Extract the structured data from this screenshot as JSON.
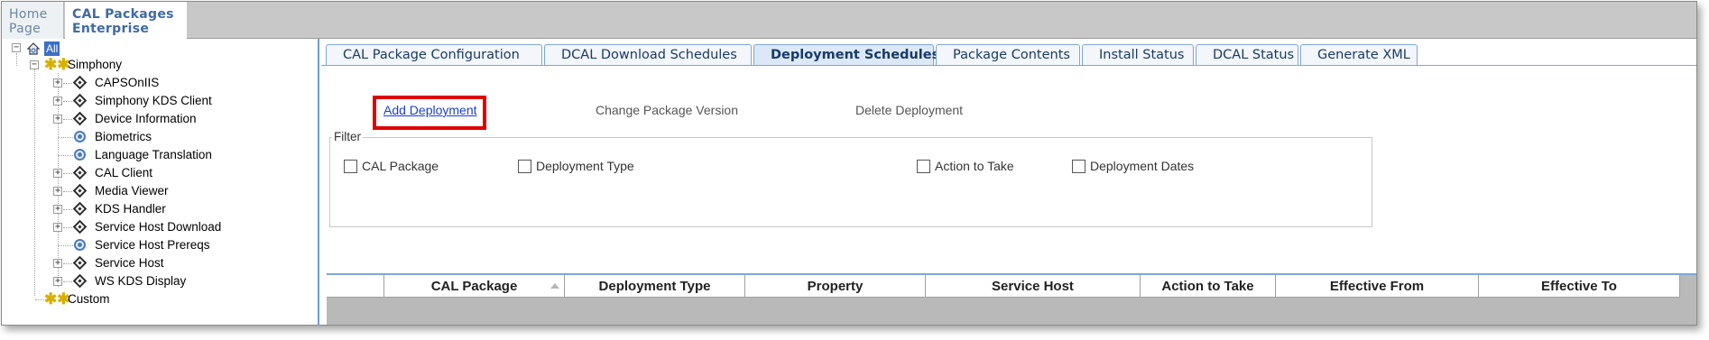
{
  "topnav": {
    "home_line1": "Home",
    "home_line2": "Page",
    "cal_line1": "CAL Packages",
    "cal_line2": "Enterprise"
  },
  "tree": {
    "root": "All",
    "simphony": "Simphony",
    "items": [
      {
        "label": "CAPSOnIIS",
        "icon": "diamond-icon"
      },
      {
        "label": "Simphony KDS Client",
        "icon": "diamond-icon"
      },
      {
        "label": "Device Information",
        "icon": "diamond-icon"
      },
      {
        "label": "Biometrics",
        "icon": "circle-icon"
      },
      {
        "label": "Language Translation",
        "icon": "circle-icon"
      },
      {
        "label": "CAL Client",
        "icon": "diamond-icon"
      },
      {
        "label": "Media Viewer",
        "icon": "diamond-icon"
      },
      {
        "label": "KDS Handler",
        "icon": "diamond-icon"
      },
      {
        "label": "Service Host Download",
        "icon": "diamond-icon"
      },
      {
        "label": "Service Host Prereqs",
        "icon": "circle-icon"
      },
      {
        "label": "Service Host",
        "icon": "diamond-icon"
      },
      {
        "label": "WS KDS Display",
        "icon": "diamond-icon"
      }
    ],
    "custom": "Custom"
  },
  "tabs": [
    {
      "label": "CAL Package Configuration"
    },
    {
      "label": "DCAL Download Schedules"
    },
    {
      "label": "Deployment Schedules",
      "active": true
    },
    {
      "label": "Package Contents"
    },
    {
      "label": "Install Status"
    },
    {
      "label": "DCAL Status"
    },
    {
      "label": "Generate XML"
    }
  ],
  "actions": {
    "add": "Add Deployment",
    "change": "Change Package Version",
    "delete": "Delete Deployment"
  },
  "filter": {
    "title": "Filter",
    "options": [
      "CAL Package",
      "Deployment Type",
      "Action to Take",
      "Deployment Dates"
    ]
  },
  "grid": {
    "columns": [
      "",
      "CAL Package",
      "Deployment Type",
      "Property",
      "Service Host",
      "Action to Take",
      "Effective From",
      "Effective To"
    ]
  },
  "colors": {
    "highlight": "#e00000",
    "link": "#1a3fd0",
    "tab_border": "#7fa6d6"
  }
}
